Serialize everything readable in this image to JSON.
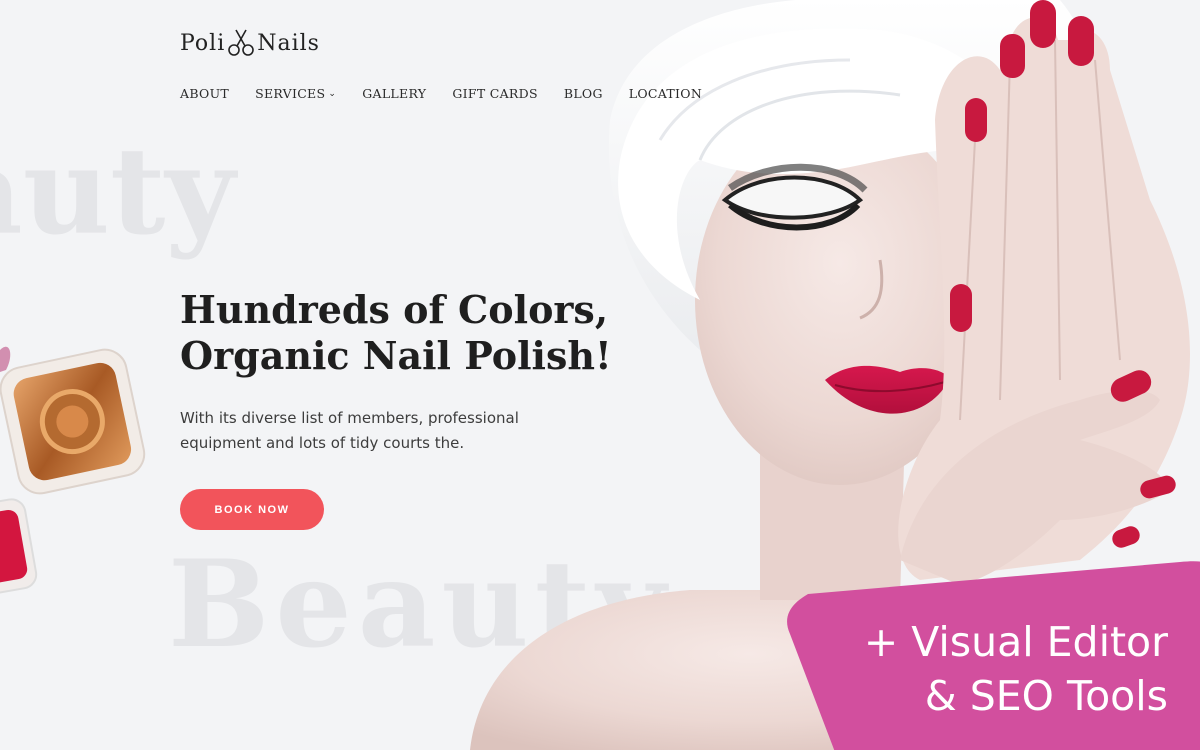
{
  "brand": {
    "name_left": "Poli",
    "name_right": "Nails"
  },
  "nav": {
    "items": [
      {
        "label": "ABOUT"
      },
      {
        "label": "SERVICES"
      },
      {
        "label": "GALLERY"
      },
      {
        "label": "GIFT CARDS"
      },
      {
        "label": "BLOG"
      },
      {
        "label": "LOCATION"
      }
    ],
    "services_chevron": "⌄"
  },
  "background_words": {
    "top": "auty",
    "bottom": "Beauty"
  },
  "hero": {
    "headline_line1": "Hundreds of Colors,",
    "headline_line2": "Organic Nail Polish!",
    "subtext_line1": "With its diverse list of members, professional",
    "subtext_line2": "equipment and lots of tidy courts the.",
    "cta_label": "BOOK NOW"
  },
  "promo": {
    "line1": "+ Visual Editor",
    "line2": "& SEO Tools"
  },
  "colors": {
    "accent": "#f2545b",
    "promo": "#d24f9e",
    "nail": "#c8193f",
    "background": "#f3f4f6"
  }
}
